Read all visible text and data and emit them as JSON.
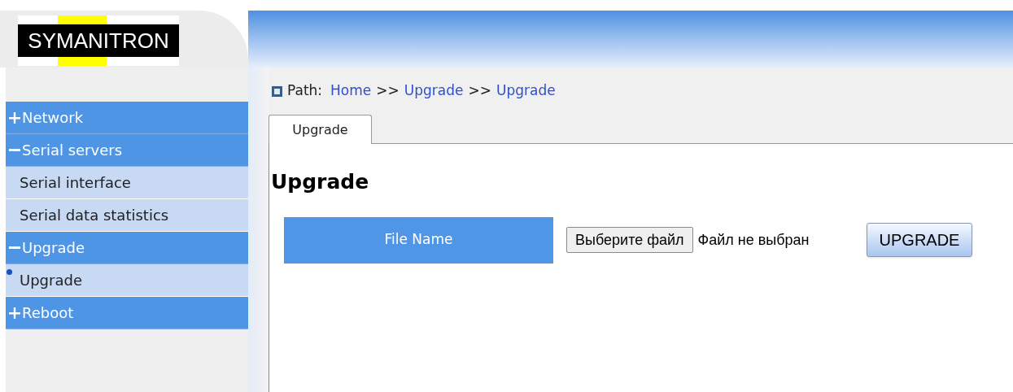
{
  "header": {
    "logo": "SYMANITRON"
  },
  "sidebar": {
    "items": [
      {
        "label": "Network",
        "expanded": false
      },
      {
        "label": "Serial servers",
        "expanded": true,
        "children": [
          {
            "label": "Serial interface",
            "selected": false
          },
          {
            "label": "Serial data statistics",
            "selected": false
          }
        ]
      },
      {
        "label": "Upgrade",
        "expanded": true,
        "children": [
          {
            "label": "Upgrade",
            "selected": true
          }
        ]
      },
      {
        "label": "Reboot",
        "expanded": false
      }
    ]
  },
  "path": {
    "label": "Path:",
    "crumbs": [
      "Home",
      "Upgrade",
      "Upgrade"
    ],
    "separator": ">>"
  },
  "tabs": [
    {
      "label": "Upgrade",
      "selected": true
    }
  ],
  "content": {
    "title": "Upgrade",
    "field_label": "File Name",
    "file_button": "Выберите файл",
    "file_status": "Файл не выбран",
    "submit": "UPGRADE"
  }
}
